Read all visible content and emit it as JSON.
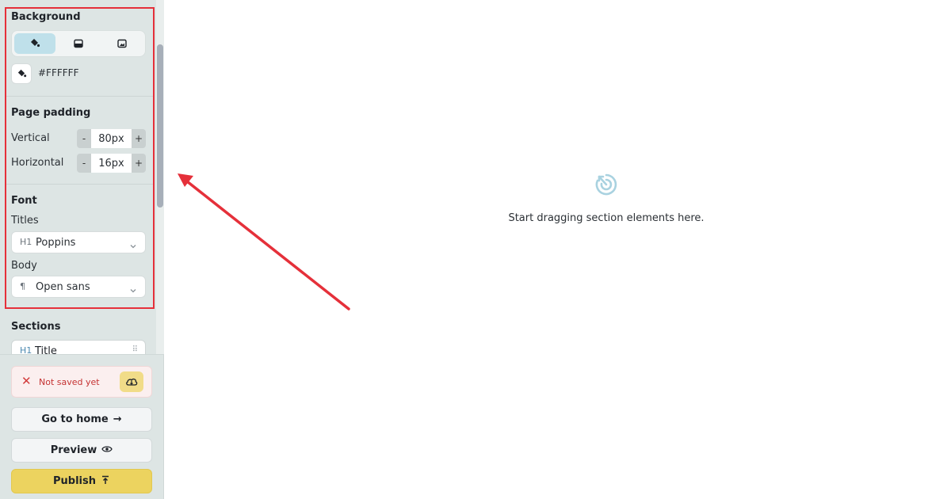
{
  "sidebar": {
    "background": {
      "title": "Background",
      "options": [
        {
          "name": "fill-color",
          "icon": "paint-bucket-icon",
          "active": true
        },
        {
          "name": "gradient",
          "icon": "gradient-icon",
          "active": false
        },
        {
          "name": "image",
          "icon": "image-icon",
          "active": false
        }
      ],
      "color_value": "#FFFFFF"
    },
    "page_padding": {
      "title": "Page padding",
      "vertical": {
        "label": "Vertical",
        "value": "80px",
        "minus": "-",
        "plus": "+"
      },
      "horizontal": {
        "label": "Horizontal",
        "value": "16px",
        "minus": "-",
        "plus": "+"
      }
    },
    "font": {
      "title": "Font",
      "titles_label": "Titles",
      "titles_icon": "H1",
      "titles_value": "Poppins",
      "body_label": "Body",
      "body_icon": "¶",
      "body_value": "Open sans"
    },
    "sections": {
      "title": "Sections",
      "items": [
        {
          "label": "Title",
          "icon": "H1"
        }
      ]
    }
  },
  "bottom": {
    "status_text": "Not saved yet",
    "status_icon": "✕",
    "go_home_label": "Go to home",
    "go_home_icon": "→",
    "preview_label": "Preview",
    "publish_label": "Publish"
  },
  "canvas": {
    "empty_text": "Start dragging section elements here."
  },
  "colors": {
    "sidebar_bg": "#dde5e4",
    "active_toggle": "#bfe0ea",
    "publish_bg": "#ecd35f",
    "error_red": "#d23b3b",
    "annotation_red": "#e5303a",
    "drop_icon": "#a9d2e0"
  }
}
